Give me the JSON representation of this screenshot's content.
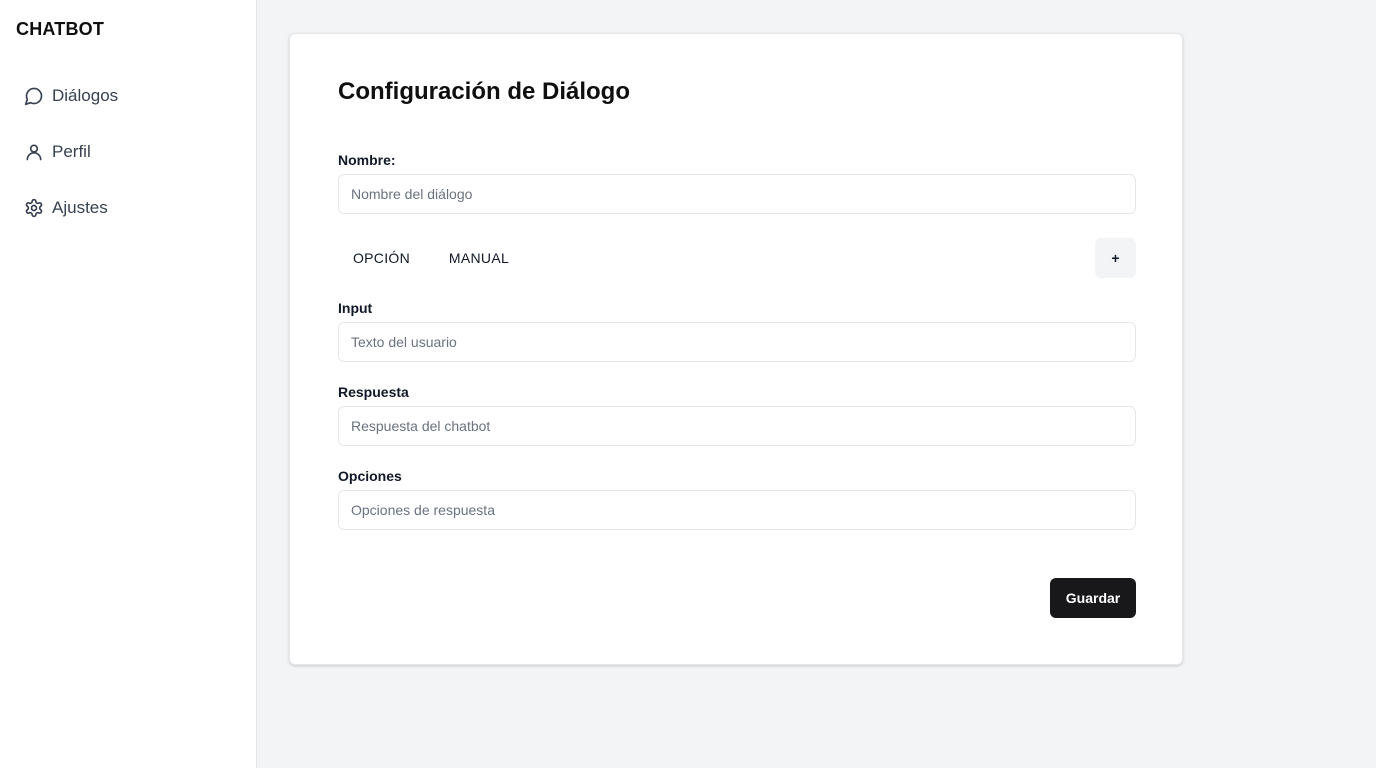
{
  "sidebar": {
    "brand": "CHATBOT",
    "items": [
      {
        "label": "Diálogos",
        "icon": "message-circle-icon"
      },
      {
        "label": "Perfil",
        "icon": "user-icon"
      },
      {
        "label": "Ajustes",
        "icon": "settings-gear-icon"
      }
    ]
  },
  "main": {
    "title": "Configuración de Diálogo",
    "name_field": {
      "label": "Nombre:",
      "placeholder": "Nombre del diálogo",
      "value": ""
    },
    "tabs": [
      {
        "label": "OPCIÓN"
      },
      {
        "label": "MANUAL"
      }
    ],
    "add_label": "+",
    "input_field": {
      "label": "Input",
      "placeholder": "Texto del usuario",
      "value": ""
    },
    "response_field": {
      "label": "Respuesta",
      "placeholder": "Respuesta del chatbot",
      "value": ""
    },
    "options_field": {
      "label": "Opciones",
      "placeholder": "Opciones de respuesta",
      "value": ""
    },
    "save_label": "Guardar"
  },
  "colors": {
    "page_background": "#f3f4f6",
    "card_background": "#ffffff",
    "primary_button": "#18181b",
    "secondary_button": "#f3f4f6",
    "border": "#e5e7eb",
    "placeholder_text": "#6b7280"
  }
}
